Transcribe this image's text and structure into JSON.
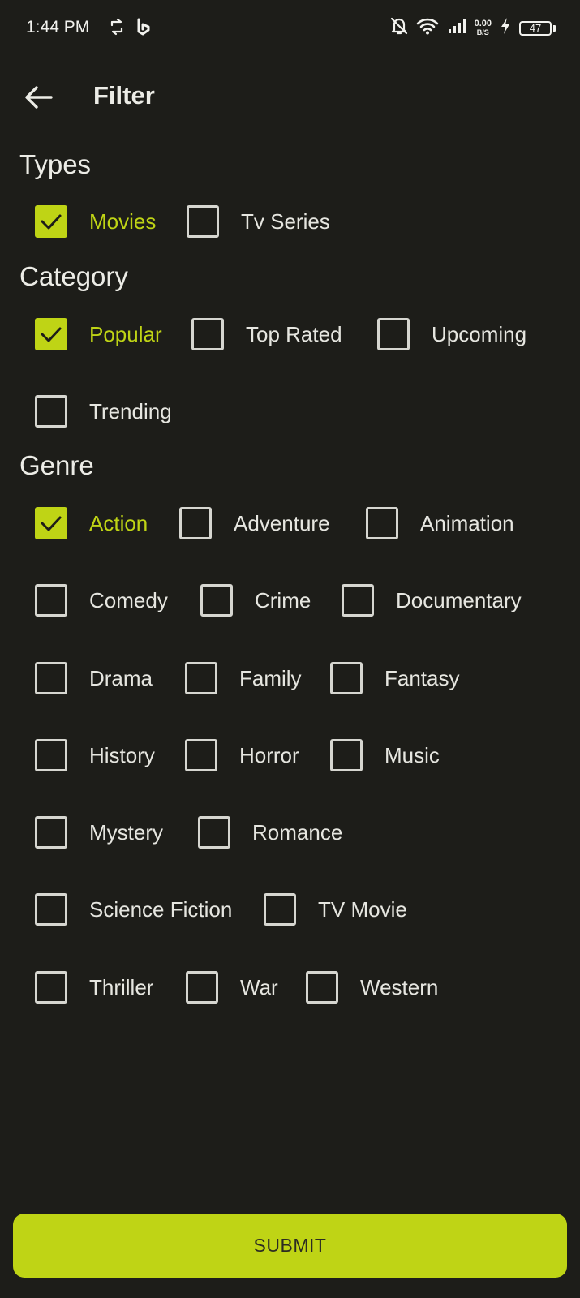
{
  "status_bar": {
    "time": "1:44 PM",
    "net_speed_value": "0.00",
    "net_speed_unit": "B/S",
    "battery_level": "47"
  },
  "app_bar": {
    "title": "Filter"
  },
  "sections": {
    "types": {
      "title": "Types",
      "options": [
        {
          "label": "Movies",
          "checked": true
        },
        {
          "label": "Tv Series",
          "checked": false
        }
      ]
    },
    "category": {
      "title": "Category",
      "options": [
        {
          "label": "Popular",
          "checked": true
        },
        {
          "label": "Top Rated",
          "checked": false
        },
        {
          "label": "Upcoming",
          "checked": false
        },
        {
          "label": "Trending",
          "checked": false
        }
      ]
    },
    "genre": {
      "title": "Genre",
      "options": [
        {
          "label": "Action",
          "checked": true
        },
        {
          "label": "Adventure",
          "checked": false
        },
        {
          "label": "Animation",
          "checked": false
        },
        {
          "label": "Comedy",
          "checked": false
        },
        {
          "label": "Crime",
          "checked": false
        },
        {
          "label": "Documentary",
          "checked": false
        },
        {
          "label": "Drama",
          "checked": false
        },
        {
          "label": "Family",
          "checked": false
        },
        {
          "label": "Fantasy",
          "checked": false
        },
        {
          "label": "History",
          "checked": false
        },
        {
          "label": "Horror",
          "checked": false
        },
        {
          "label": "Music",
          "checked": false
        },
        {
          "label": "Mystery",
          "checked": false
        },
        {
          "label": "Romance",
          "checked": false
        },
        {
          "label": "Science Fiction",
          "checked": false
        },
        {
          "label": "TV Movie",
          "checked": false
        },
        {
          "label": "Thriller",
          "checked": false
        },
        {
          "label": "War",
          "checked": false
        },
        {
          "label": "Western",
          "checked": false
        }
      ]
    }
  },
  "submit_label": "SUBMIT",
  "colors": {
    "accent": "#bfd415",
    "background": "#1d1d19",
    "text": "#e6e6e0"
  }
}
